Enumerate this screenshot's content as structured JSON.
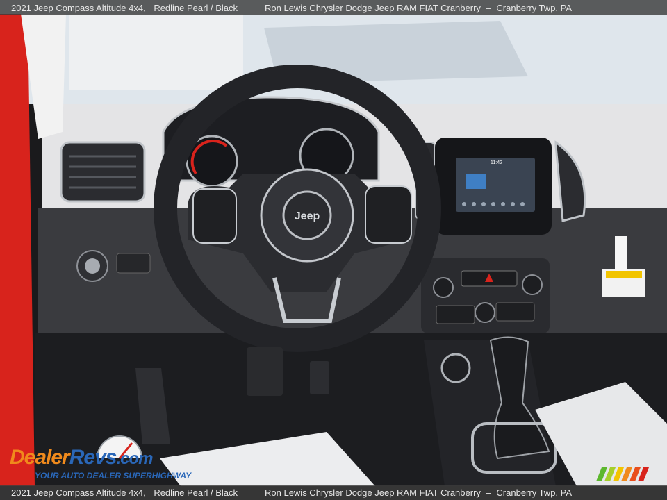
{
  "caption": {
    "vehicle": "2021 Jeep Compass Altitude 4x4,",
    "color": "Redline Pearl / Black",
    "dealer": "Ron Lewis Chrysler Dodge Jeep RAM FIAT Cranberry",
    "location": "Cranberry Twp, PA",
    "dash": "–"
  },
  "steering_badge": "Jeep",
  "watermark": {
    "brand_left": "Dealer",
    "brand_right": "Revs",
    "brand_tld": ".com",
    "tagline": "YOUR AUTO DEALER SUPERHIGHWAY"
  },
  "screen": {
    "time": "11:42"
  },
  "colors": {
    "exterior_red": "#d8231c",
    "interior_dark": "#2a2b2e",
    "dash_light": "#e6e6e8",
    "logo_orange": "#f08a1c",
    "logo_blue": "#2a67b8"
  }
}
